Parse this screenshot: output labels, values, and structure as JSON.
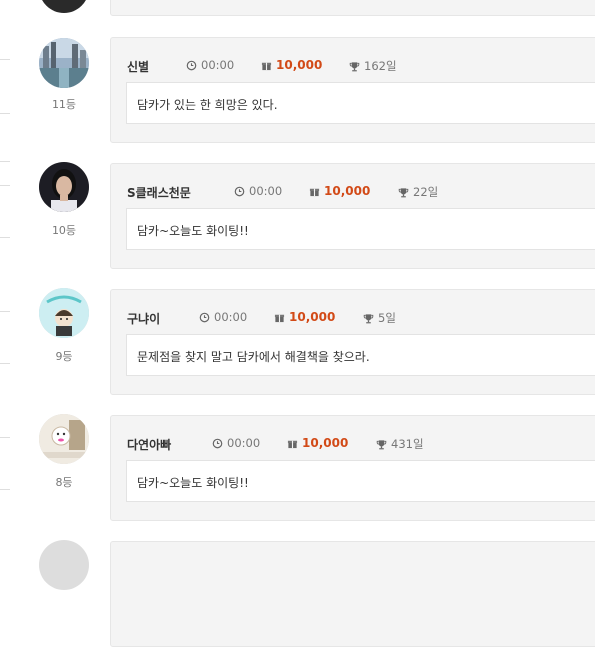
{
  "entries": [
    {
      "rank": "11등",
      "name": "신별",
      "time": "00:00",
      "points": "10,000",
      "days": "162일",
      "message": "담카가 있는 한 희망은 있다."
    },
    {
      "rank": "10등",
      "name": "S클래스천문",
      "time": "00:00",
      "points": "10,000",
      "days": "22일",
      "message": "담카~오늘도 화이팅!!"
    },
    {
      "rank": "9등",
      "name": "구냐이",
      "time": "00:00",
      "points": "10,000",
      "days": "5일",
      "message": "문제점을 찾지 말고 담카에서 해결책을 찾으라."
    },
    {
      "rank": "8등",
      "name": "다연아빠",
      "time": "00:00",
      "points": "10,000",
      "days": "431일",
      "message": "담카~오늘도 화이팅!!"
    }
  ],
  "icons": {
    "time": "clock-icon",
    "points": "gift-icon",
    "days": "trophy-icon"
  },
  "colors": {
    "points": "#d24a17",
    "card_bg": "#f4f4f4"
  }
}
